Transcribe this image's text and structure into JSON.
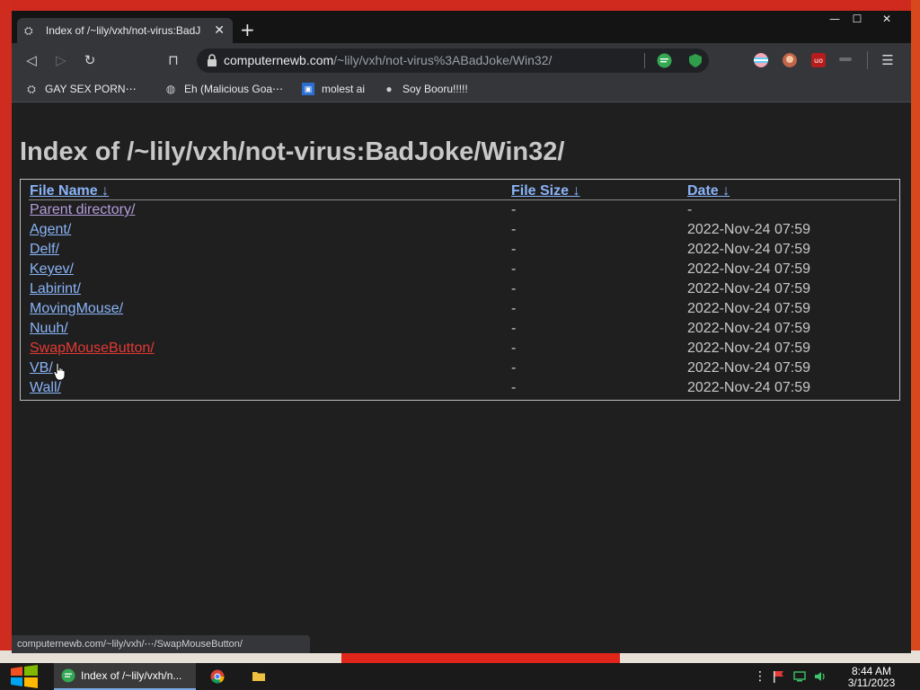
{
  "tab": {
    "title": "Index of /~lily/vxh/not-virus:BadJ",
    "close": "✕"
  },
  "newtab": "+",
  "window_controls": {
    "minimize": "—",
    "maximize": "☐",
    "close": "✕"
  },
  "toolbar": {
    "back": "◁",
    "forward": "▷",
    "reload": "↻",
    "bookmark": "⊓"
  },
  "address": {
    "host": "computernewb.com",
    "path": "/~lily/vxh/not-virus%3ABadJoke/Win32/"
  },
  "bookmarks": [
    {
      "label": "GAY SEX PORN⋯",
      "icon": "frog-icon"
    },
    {
      "label": "Eh (Malicious Goa⋯",
      "icon": "globe-icon"
    },
    {
      "label": "molest ai",
      "icon": "ai-icon"
    },
    {
      "label": "Soy Booru!!!!!",
      "icon": "soy-icon"
    }
  ],
  "page": {
    "title": "Index of /~lily/vxh/not-virus:BadJoke/Win32/",
    "headers": {
      "name": "File Name",
      "size": "File Size",
      "date": "Date",
      "sort": "↓"
    },
    "rows": [
      {
        "name": "Parent directory/",
        "size": "-",
        "date": "-"
      },
      {
        "name": "Agent/",
        "size": "-",
        "date": "2022-Nov-24 07:59"
      },
      {
        "name": "Delf/",
        "size": "-",
        "date": "2022-Nov-24 07:59"
      },
      {
        "name": "Keyev/",
        "size": "-",
        "date": "2022-Nov-24 07:59"
      },
      {
        "name": "Labirint/",
        "size": "-",
        "date": "2022-Nov-24 07:59"
      },
      {
        "name": "MovingMouse/",
        "size": "-",
        "date": "2022-Nov-24 07:59"
      },
      {
        "name": "Nuuh/",
        "size": "-",
        "date": "2022-Nov-24 07:59"
      },
      {
        "name": "SwapMouseButton/",
        "size": "-",
        "date": "2022-Nov-24 07:59"
      },
      {
        "name": "VB/",
        "size": "-",
        "date": "2022-Nov-24 07:59"
      },
      {
        "name": "Wall/",
        "size": "-",
        "date": "2022-Nov-24 07:59"
      }
    ]
  },
  "status": "computernewb.com/~lily/vxh/⋯/SwapMouseButton/",
  "taskbar": {
    "task_label": "Index of /~lily/vxh/n...",
    "time": "8:44 AM",
    "date": "3/11/2023"
  },
  "colors": {
    "link": "#8ab4f8",
    "visited": "#b39ddb",
    "hover": "#e53935",
    "desktop": "#c8271c"
  }
}
